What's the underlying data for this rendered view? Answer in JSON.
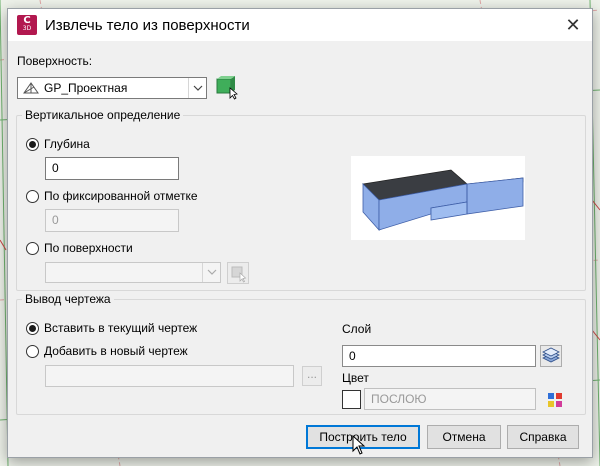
{
  "dialog": {
    "title": "Извлечь тело из поверхности",
    "app_icon_text": "C",
    "app_icon_subtext": "3D"
  },
  "surface": {
    "label": "Поверхность:",
    "selected": "GP_Проектная"
  },
  "vertical": {
    "group_title": "Вертикальное определение",
    "depth_label": "Глубина",
    "depth_value": "0",
    "fixed_label": "По фиксированной отметке",
    "fixed_value": "0",
    "by_surface_label": "По поверхности",
    "by_surface_selected": ""
  },
  "output": {
    "group_title": "Вывод чертежа",
    "insert_current_label": "Вставить в текущий чертеж",
    "add_new_label": "Добавить в новый чертеж",
    "new_drawing_path": "",
    "browse_label": "...",
    "layer_label": "Слой",
    "layer_value": "0",
    "color_label": "Цвет",
    "color_value": "ПОСЛОЮ"
  },
  "buttons": {
    "build": "Построить тело",
    "cancel": "Отмена",
    "help": "Справка"
  },
  "colors": {
    "app_icon": "#b2184f",
    "solid_top": "#3a3d42",
    "solid_side": "#8faee8",
    "accent": "#0078d7"
  }
}
